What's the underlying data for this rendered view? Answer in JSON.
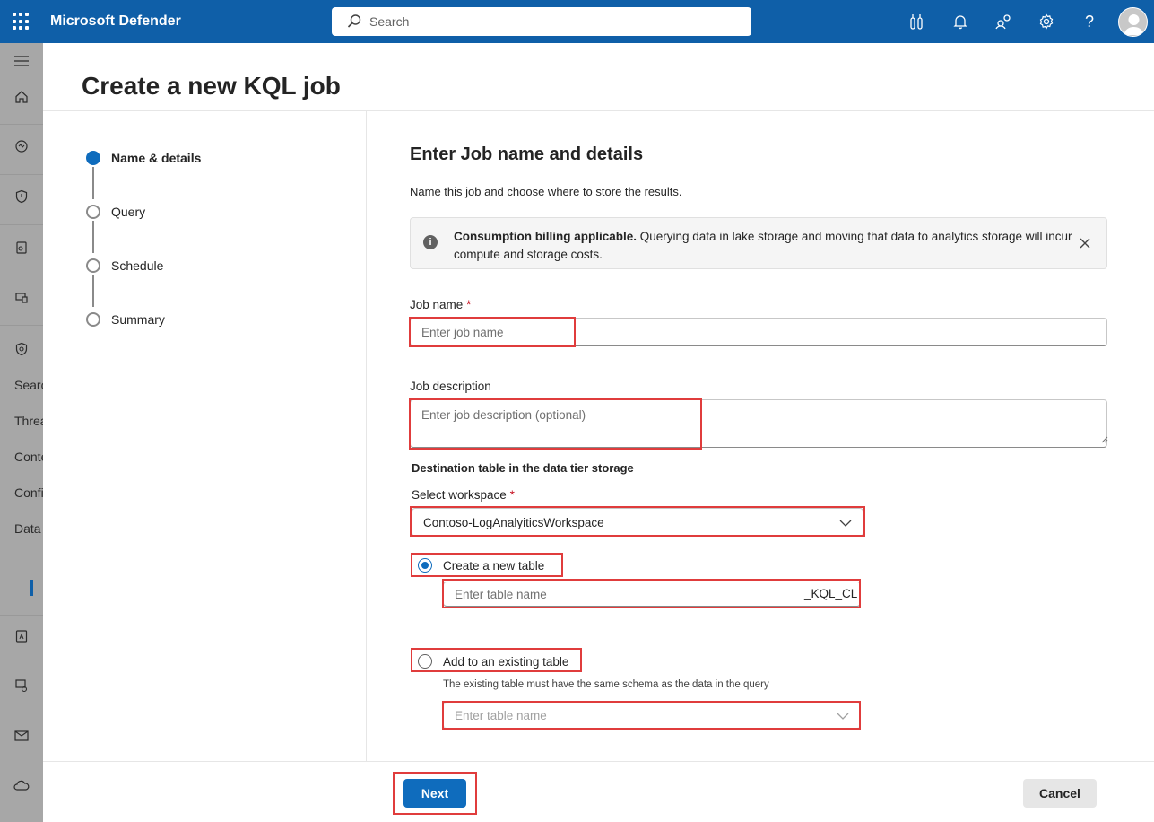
{
  "app": {
    "title": "Microsoft Defender",
    "search_placeholder": "Search",
    "header_icons": [
      "feature-tour-icon",
      "bell-icon",
      "community-icon",
      "gear-icon",
      "help-icon"
    ]
  },
  "rail": {
    "icons": [
      "hamburger-icon",
      "home-icon",
      "incidents-icon",
      "shield-icon",
      "assets-icon",
      "devices-icon",
      "hunting-icon"
    ],
    "items": [
      "Search",
      "Threa",
      "Conte",
      "Confi",
      "Data"
    ],
    "bottom_icons": [
      "reports-icon",
      "learning-icon",
      "email-icon",
      "cloud-icon"
    ]
  },
  "page": {
    "title": "Create a new KQL job"
  },
  "steps": [
    {
      "label": "Name & details",
      "active": true
    },
    {
      "label": "Query",
      "active": false
    },
    {
      "label": "Schedule",
      "active": false
    },
    {
      "label": "Summary",
      "active": false
    }
  ],
  "form": {
    "title": "Enter Job name and details",
    "subtitle": "Name this job and choose where to store the results.",
    "banner": {
      "bold": "Consumption billing applicable.",
      "text": " Querying data in lake storage and moving that data to analytics storage will incur compute and storage costs."
    },
    "job_name": {
      "label": "Job name",
      "required": "*",
      "placeholder": "Enter job name",
      "value": ""
    },
    "job_description": {
      "label": "Job description",
      "placeholder": "Enter job description (optional)",
      "value": ""
    },
    "destination_heading": "Destination table in the data tier storage",
    "workspace": {
      "label": "Select workspace",
      "required": "*",
      "value": "Contoso-LogAnalyiticsWorkspace"
    },
    "create_new_table": {
      "label": "Create a new table",
      "selected": true,
      "placeholder": "Enter table name",
      "suffix": "_KQL_CL"
    },
    "existing_table": {
      "label": "Add to an existing table",
      "selected": false,
      "hint": "The existing table must have the same schema as the data in the query",
      "placeholder": "Enter table name"
    }
  },
  "footer": {
    "next_label": "Next",
    "cancel_label": "Cancel"
  },
  "colors": {
    "header_bg": "#0f5fa8",
    "accent": "#0f6cbd",
    "highlight": "#e03c3c",
    "rail_bg": "#a7a7a7"
  }
}
